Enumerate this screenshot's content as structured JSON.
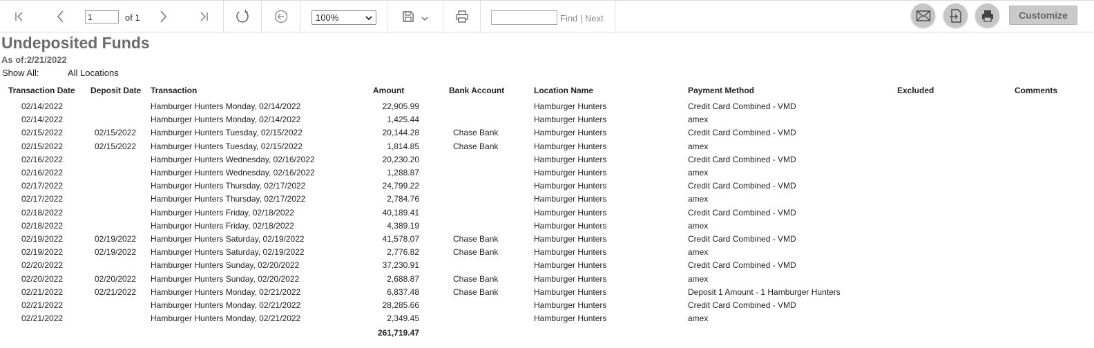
{
  "toolbar": {
    "page_number": "1",
    "page_of": "of 1",
    "zoom": "100%",
    "find_placeholder": "",
    "find_label": "Find",
    "find_separator": "|",
    "next_label": "Next",
    "customize_label": "Customize",
    "icons": [
      "first-page-icon",
      "prev-page-icon",
      "next-page-icon",
      "last-page-icon",
      "refresh-icon",
      "back-icon",
      "save-icon",
      "chevron-down-icon",
      "print-icon",
      "email-icon",
      "export-icon",
      "print-circle-icon"
    ]
  },
  "report": {
    "title": "Undeposited Funds",
    "as_of_label": "As of:",
    "as_of_value": "2/21/2022",
    "show_all_label": "Show All:",
    "show_all_value": "All Locations",
    "columns": [
      "Transaction Date",
      "Deposit Date",
      "Transaction",
      "Amount",
      "Bank Account",
      "Location Name",
      "Payment Method",
      "Excluded",
      "Comments"
    ],
    "rows": [
      {
        "tdate": "02/14/2022",
        "ddate": "",
        "transaction": "Hamburger Hunters Monday, 02/14/2022",
        "amount": "22,905.99",
        "bank": "",
        "location": "Hamburger Hunters",
        "method": "Credit Card Combined - VMD"
      },
      {
        "tdate": "02/14/2022",
        "ddate": "",
        "transaction": "Hamburger Hunters Monday, 02/14/2022",
        "amount": "1,425.44",
        "bank": "",
        "location": "Hamburger Hunters",
        "method": "amex"
      },
      {
        "tdate": "02/15/2022",
        "ddate": "02/15/2022",
        "transaction": "Hamburger Hunters Tuesday, 02/15/2022",
        "amount": "20,144.28",
        "bank": "Chase Bank",
        "location": "Hamburger Hunters",
        "method": "Credit Card Combined - VMD"
      },
      {
        "tdate": "02/15/2022",
        "ddate": "02/15/2022",
        "transaction": "Hamburger Hunters Tuesday, 02/15/2022",
        "amount": "1,814.85",
        "bank": "Chase Bank",
        "location": "Hamburger Hunters",
        "method": "amex"
      },
      {
        "tdate": "02/16/2022",
        "ddate": "",
        "transaction": "Hamburger Hunters Wednesday, 02/16/2022",
        "amount": "20,230.20",
        "bank": "",
        "location": "Hamburger Hunters",
        "method": "Credit Card Combined - VMD"
      },
      {
        "tdate": "02/16/2022",
        "ddate": "",
        "transaction": "Hamburger Hunters Wednesday, 02/16/2022",
        "amount": "1,288.87",
        "bank": "",
        "location": "Hamburger Hunters",
        "method": "amex"
      },
      {
        "tdate": "02/17/2022",
        "ddate": "",
        "transaction": "Hamburger Hunters Thursday, 02/17/2022",
        "amount": "24,799.22",
        "bank": "",
        "location": "Hamburger Hunters",
        "method": "Credit Card Combined - VMD"
      },
      {
        "tdate": "02/17/2022",
        "ddate": "",
        "transaction": "Hamburger Hunters Thursday, 02/17/2022",
        "amount": "2,784.76",
        "bank": "",
        "location": "Hamburger Hunters",
        "method": "amex"
      },
      {
        "tdate": "02/18/2022",
        "ddate": "",
        "transaction": "Hamburger Hunters Friday, 02/18/2022",
        "amount": "40,189.41",
        "bank": "",
        "location": "Hamburger Hunters",
        "method": "Credit Card Combined - VMD"
      },
      {
        "tdate": "02/18/2022",
        "ddate": "",
        "transaction": "Hamburger Hunters Friday, 02/18/2022",
        "amount": "4,389.19",
        "bank": "",
        "location": "Hamburger Hunters",
        "method": "amex"
      },
      {
        "tdate": "02/19/2022",
        "ddate": "02/19/2022",
        "transaction": "Hamburger Hunters Saturday, 02/19/2022",
        "amount": "41,578.07",
        "bank": "Chase Bank",
        "location": "Hamburger Hunters",
        "method": "Credit Card Combined - VMD"
      },
      {
        "tdate": "02/19/2022",
        "ddate": "02/19/2022",
        "transaction": "Hamburger Hunters Saturday, 02/19/2022",
        "amount": "2,776.82",
        "bank": "Chase Bank",
        "location": "Hamburger Hunters",
        "method": "amex"
      },
      {
        "tdate": "02/20/2022",
        "ddate": "",
        "transaction": "Hamburger Hunters Sunday, 02/20/2022",
        "amount": "37,230.91",
        "bank": "",
        "location": "Hamburger Hunters",
        "method": "Credit Card Combined - VMD"
      },
      {
        "tdate": "02/20/2022",
        "ddate": "02/20/2022",
        "transaction": "Hamburger Hunters Sunday, 02/20/2022",
        "amount": "2,688.87",
        "bank": "Chase Bank",
        "location": "Hamburger Hunters",
        "method": "amex"
      },
      {
        "tdate": "02/21/2022",
        "ddate": "02/21/2022",
        "transaction": "Hamburger Hunters Monday, 02/21/2022",
        "amount": "6,837.48",
        "bank": "Chase Bank",
        "location": "Hamburger Hunters",
        "method": "Deposit 1 Amount - 1 Hamburger Hunters"
      },
      {
        "tdate": "02/21/2022",
        "ddate": "",
        "transaction": "Hamburger Hunters Monday, 02/21/2022",
        "amount": "28,285.66",
        "bank": "",
        "location": "Hamburger Hunters",
        "method": "Credit Card Combined - VMD"
      },
      {
        "tdate": "02/21/2022",
        "ddate": "",
        "transaction": "Hamburger Hunters Monday, 02/21/2022",
        "amount": "2,349.45",
        "bank": "",
        "location": "Hamburger Hunters",
        "method": "amex"
      }
    ],
    "total_amount": "261,719.47"
  }
}
